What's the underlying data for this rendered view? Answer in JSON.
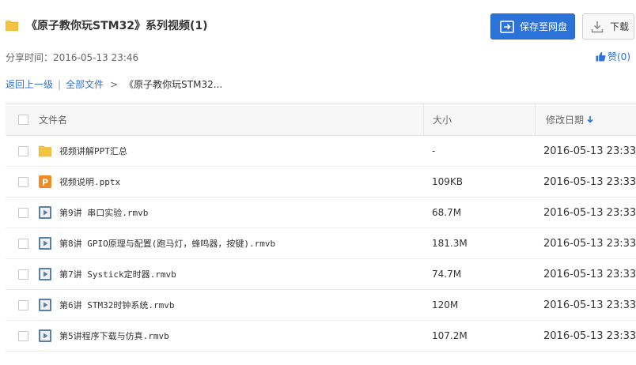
{
  "header": {
    "title": "《原子教你玩STM32》系列视频(1)",
    "save_label": "保存至网盘",
    "download_label": "下载"
  },
  "meta": {
    "share_time": "分享时间：2016-05-13 23:46",
    "like_label": "赞(0)"
  },
  "breadcrumb": {
    "back": "返回上一级",
    "all_files": "全部文件",
    "current": "《原子教你玩STM32..."
  },
  "table": {
    "col_name": "文件名",
    "col_size": "大小",
    "col_date": "修改日期"
  },
  "files": [
    {
      "type": "folder",
      "name": "视频讲解PPT汇总",
      "size": "-",
      "date": "2016-05-13 23:33"
    },
    {
      "type": "pptx",
      "name": "视频说明.pptx",
      "size": "109KB",
      "date": "2016-05-13 23:33"
    },
    {
      "type": "video",
      "name": "第9讲 串口实验.rmvb",
      "size": "68.7M",
      "date": "2016-05-13 23:33"
    },
    {
      "type": "video",
      "name": "第8讲 GPIO原理与配置(跑马灯，蜂鸣器，按键).rmvb",
      "size": "181.3M",
      "date": "2016-05-13 23:33"
    },
    {
      "type": "video",
      "name": "第7讲 Systick定时器.rmvb",
      "size": "74.7M",
      "date": "2016-05-13 23:33"
    },
    {
      "type": "video",
      "name": "第6讲 STM32时钟系统.rmvb",
      "size": "120M",
      "date": "2016-05-13 23:33"
    },
    {
      "type": "video",
      "name": "第5讲程序下载与仿真.rmvb",
      "size": "107.2M",
      "date": "2016-05-13 23:33"
    }
  ],
  "colors": {
    "accent": "#2c73d9",
    "folder": "#f5c342",
    "pptx": "#f08a24",
    "video": "#5b7fa6"
  }
}
